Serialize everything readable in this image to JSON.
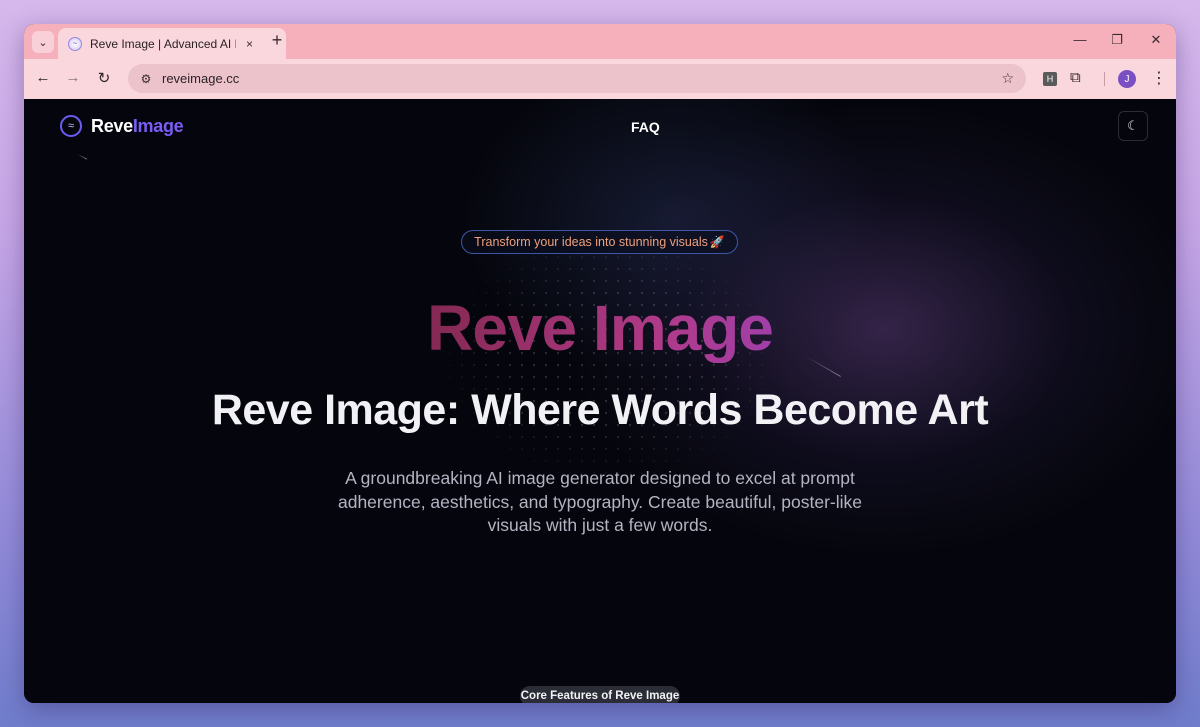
{
  "browser": {
    "tab": {
      "title": "Reve Image | Advanced AI Imag",
      "close_icon": "×"
    },
    "new_tab_icon": "+",
    "window_controls": {
      "minimize": "—",
      "restore": "❐",
      "close": "✕"
    },
    "toolbar": {
      "back_icon": "←",
      "forward_icon": "→",
      "reload_icon": "↻",
      "url": "reveimage.cc",
      "bookmark_icon": "☆",
      "extension_label": "H",
      "profile_initial": "J",
      "menu_icon": "⋮"
    }
  },
  "page": {
    "logo": {
      "part1": "Reve",
      "part2": "Image"
    },
    "nav": {
      "faq": "FAQ"
    },
    "theme_toggle_icon": "☾",
    "badge": {
      "text": "Transform your ideas into stunning visuals",
      "emoji": "🚀"
    },
    "hero": {
      "title": "Reve Image",
      "subtitle": "Reve Image: Where Words Become Art",
      "description": "A groundbreaking AI image generator designed to excel at prompt adherence, aesthetics, and typography. Create beautiful, poster-like visuals with just a few words."
    },
    "features": {
      "pill": "Core Features of Reve Image"
    }
  },
  "colors": {
    "page_background": "#05060d",
    "tab_strip": "#f6b0bc",
    "toolbar": "#f9d7dd",
    "brand_purple": "#7b5cf5",
    "badge_text": "#f0a07a",
    "badge_border": "#3d56a8"
  }
}
